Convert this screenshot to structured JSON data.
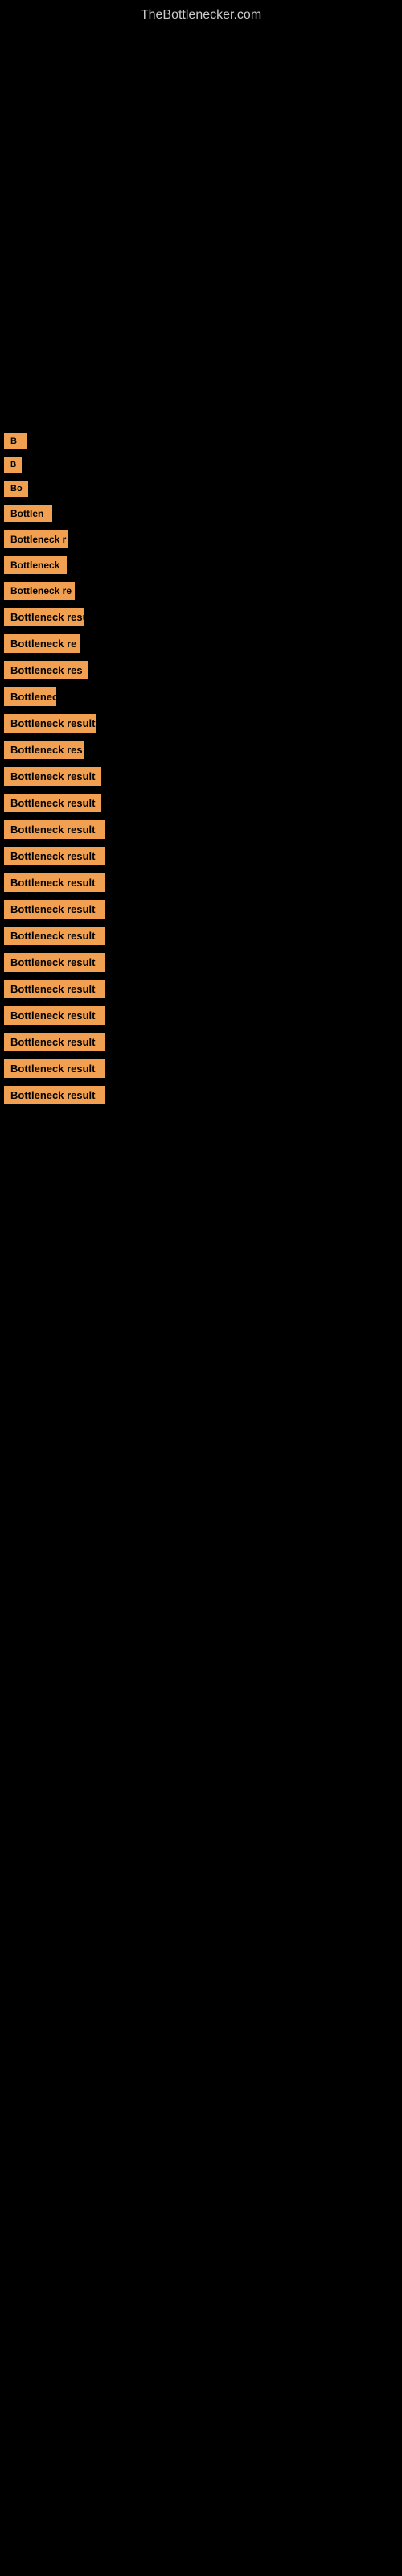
{
  "site": {
    "title": "TheBottlenecker.com"
  },
  "items": [
    {
      "id": 1,
      "label": "B"
    },
    {
      "id": 2,
      "label": "B"
    },
    {
      "id": 3,
      "label": "Bo"
    },
    {
      "id": 4,
      "label": "Bottlen"
    },
    {
      "id": 5,
      "label": "Bottleneck r"
    },
    {
      "id": 6,
      "label": "Bottleneck"
    },
    {
      "id": 7,
      "label": "Bottleneck re"
    },
    {
      "id": 8,
      "label": "Bottleneck resu"
    },
    {
      "id": 9,
      "label": "Bottleneck re"
    },
    {
      "id": 10,
      "label": "Bottleneck res"
    },
    {
      "id": 11,
      "label": "Bottleneck"
    },
    {
      "id": 12,
      "label": "Bottleneck result"
    },
    {
      "id": 13,
      "label": "Bottleneck res"
    },
    {
      "id": 14,
      "label": "Bottleneck result"
    },
    {
      "id": 15,
      "label": "Bottleneck result"
    },
    {
      "id": 16,
      "label": "Bottleneck result"
    },
    {
      "id": 17,
      "label": "Bottleneck result"
    },
    {
      "id": 18,
      "label": "Bottleneck result"
    },
    {
      "id": 19,
      "label": "Bottleneck result"
    },
    {
      "id": 20,
      "label": "Bottleneck result"
    },
    {
      "id": 21,
      "label": "Bottleneck result"
    },
    {
      "id": 22,
      "label": "Bottleneck result"
    },
    {
      "id": 23,
      "label": "Bottleneck result"
    },
    {
      "id": 24,
      "label": "Bottleneck result"
    },
    {
      "id": 25,
      "label": "Bottleneck result"
    },
    {
      "id": 26,
      "label": "Bottleneck result"
    }
  ]
}
